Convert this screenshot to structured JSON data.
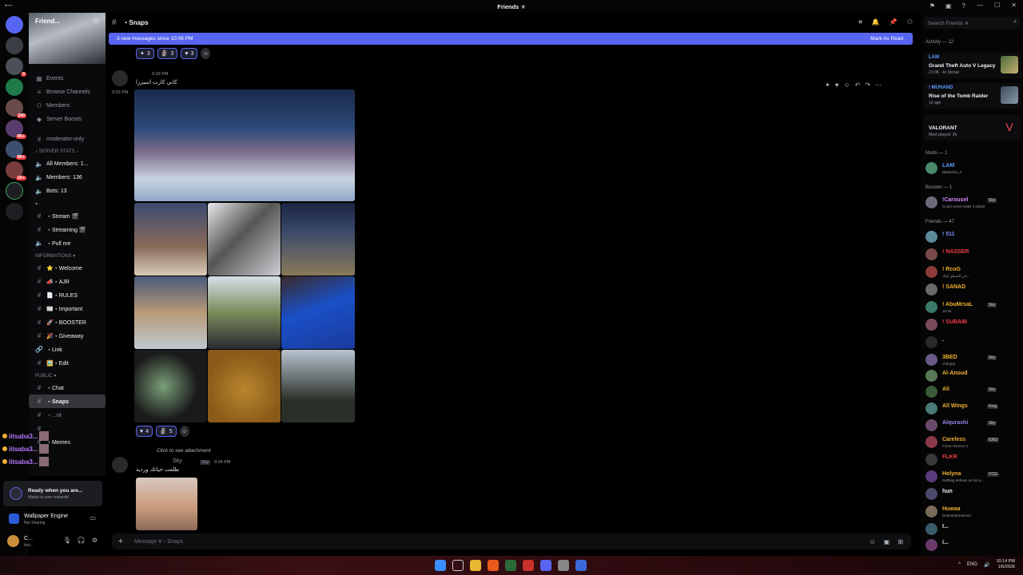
{
  "window": {
    "title": "Friends ✭"
  },
  "server": {
    "name": "Friend...",
    "nav": [
      {
        "icon": "calendar-icon",
        "label": "Events"
      },
      {
        "icon": "browse-icon",
        "label": "Browse Channels"
      },
      {
        "icon": "members-icon",
        "label": "Members"
      },
      {
        "icon": "boost-icon",
        "label": "Server Boosts"
      }
    ],
    "channels": [
      {
        "type": "text",
        "label": "moderator-only"
      },
      {
        "type": "cat",
        "label": "♪ SERVER STATS ♪"
      },
      {
        "type": "stat",
        "label": "All Members: 1..."
      },
      {
        "type": "stat",
        "label": "Members: 136"
      },
      {
        "type": "stat",
        "label": "Bots: 13"
      },
      {
        "type": "cat",
        "label": "▾ -"
      },
      {
        "type": "voice",
        "label": "・Stream 🎬"
      },
      {
        "type": "voice",
        "label": "・Streaming 🎬"
      },
      {
        "type": "voice",
        "label": "・Pull me"
      },
      {
        "type": "cat",
        "label": "INFORMATIONS ▾"
      },
      {
        "type": "text",
        "label": "⭐・Welcome"
      },
      {
        "type": "text",
        "label": "📣・AJR"
      },
      {
        "type": "text",
        "label": "📄・RULES"
      },
      {
        "type": "text",
        "label": "📰・Important"
      },
      {
        "type": "text",
        "label": "🚀・BOOSTER"
      },
      {
        "type": "text",
        "label": "🎉・Giveaway"
      },
      {
        "type": "link",
        "label": "・Link"
      },
      {
        "type": "text",
        "label": "🖼️・Edit"
      },
      {
        "type": "cat",
        "label": "PUBLIC ▾"
      },
      {
        "type": "text",
        "label": "・Chat"
      },
      {
        "type": "active",
        "label": "・Snaps"
      },
      {
        "type": "text",
        "label": "・...nt"
      },
      {
        "type": "text",
        "label": "・Memes"
      }
    ],
    "voice_users": [
      "iitsaba3...",
      "iitsaba3...",
      "iitsaba3..."
    ]
  },
  "quest": {
    "title": "Ready when you are...",
    "subtitle": "Watch to earn rewards!"
  },
  "activity_widget": {
    "app": "Wallpaper Engine",
    "status": "Not Sharing"
  },
  "user": {
    "name": "C...",
    "status": "Invi..."
  },
  "channel": {
    "name": "・Snaps",
    "new_messages": "3 new messages since 10:06 PM",
    "mark_read": "Mark As Read",
    "composer_placeholder": "Message #・Snaps"
  },
  "messages": {
    "m1_reactions": [
      {
        "e": "✦",
        "n": "3"
      },
      {
        "e": "🗿",
        "n": "3"
      },
      {
        "e": "♥",
        "n": "3"
      }
    ],
    "m2_time_head": "9:03 PM",
    "m2_time_side": "9:03 PM",
    "m2_text": "كاني كارت اسيزرا",
    "m2_reactions": [
      {
        "e": "♥",
        "n": "4"
      },
      {
        "e": "🗿",
        "n": "5"
      }
    ],
    "reply_hint": "Click to see attachment",
    "m3_user": "Sky",
    "m3_tag": "Sky",
    "m3_time": "9:34 PM",
    "m3_text": "طلعت حياتك وردية"
  },
  "right_panel": {
    "search_placeholder": "Search Friends ✭",
    "activity_title": "Activity — 12",
    "activities": [
      {
        "who": "LAM",
        "game": "Grand Theft Auto V Legacy",
        "meta": "21:08 · 4x Streak"
      },
      {
        "who": "! MUHAND",
        "game": "Rise of the Tomb Raider",
        "meta": "1d ago"
      },
      {
        "who": "",
        "game": "VALORANT",
        "meta": "Most played: 3h"
      }
    ],
    "mods_title": "Mods — 1",
    "booster_title": "Booster — 1",
    "friends_title": "Friends — 47",
    "members": [
      {
        "name": "LAM",
        "status": "Bladreina_2",
        "color": "#5e9bff",
        "tag": ""
      },
      {
        "name": "!Carousel",
        "status": "Could never make it alright",
        "color": "#d68cff",
        "tag": "Sky"
      },
      {
        "name": "! 511",
        "status": "",
        "color": "#7b8cff",
        "tag": ""
      },
      {
        "name": "! NASSER",
        "status": "",
        "color": "#f23f43",
        "tag": ""
      },
      {
        "name": "! RcoG",
        "status": "حن المنطق أولاد...",
        "color": "#f0b232",
        "tag": ""
      },
      {
        "name": "! SANAD",
        "status": "",
        "color": "#f0b232",
        "tag": ""
      },
      {
        "name": "! AbuMrsaL",
        "status": "15:45",
        "color": "#f0b232",
        "tag": "Sky"
      },
      {
        "name": "! SUBAIB",
        "status": "",
        "color": "#f23f43",
        "tag": ""
      },
      {
        "name": ".",
        "status": "",
        "color": "#dbdee1",
        "tag": ""
      },
      {
        "name": "3BED",
        "status": "chill guy",
        "color": "#f0b232",
        "tag": "Sky"
      },
      {
        "name": "Al-Anoud",
        "status": "",
        "color": "#f0b232",
        "tag": ""
      },
      {
        "name": "Ali",
        "status": "",
        "color": "#f0b232",
        "tag": "Sky"
      },
      {
        "name": "All Wings",
        "status": "",
        "color": "#f0b232",
        "tag": "King"
      },
      {
        "name": "Alqurashi",
        "status": "",
        "color": "#9b84ec",
        "tag": "Sky"
      },
      {
        "name": "Careless",
        "status": "Forza Horizon 5",
        "color": "#f0b232",
        "tag": "6363"
      },
      {
        "name": "FLKR",
        "status": "",
        "color": "#f23f43",
        "tag": ""
      },
      {
        "name": "Holyna",
        "status": "Nothing defines us but a...",
        "color": "#f0b232",
        "tag": "YCG"
      },
      {
        "name": "hun",
        "status": "",
        "color": "#f2f3f5",
        "tag": ""
      },
      {
        "name": "Huwaa",
        "status": "Dodododoreamon",
        "color": "#f0b232",
        "tag": ""
      },
      {
        "name": "I...",
        "status": "",
        "color": "#f2f3f5",
        "tag": ""
      },
      {
        "name": "i...",
        "status": "",
        "color": "#f2f3f5",
        "tag": ""
      }
    ]
  },
  "taskbar": {
    "lang": "ENG",
    "time": "10:14 PM",
    "date": "1/6/2026"
  }
}
